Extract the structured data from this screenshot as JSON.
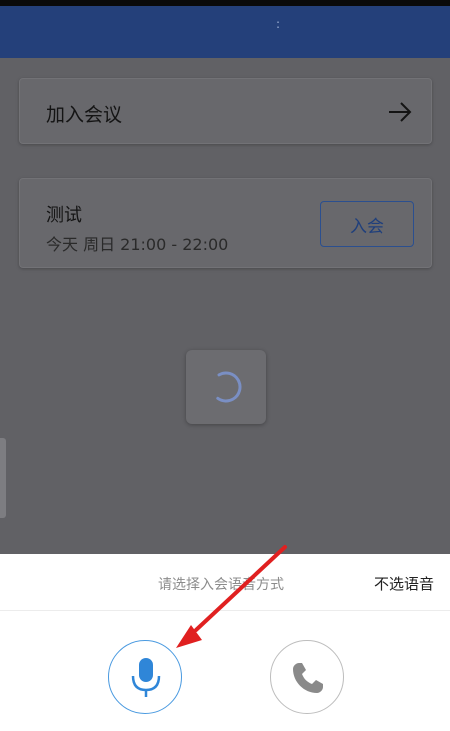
{
  "header": {
    "dots": ":"
  },
  "join_card": {
    "label": "加入会议",
    "icon": "arrow-right-icon"
  },
  "meeting": {
    "title": "测试",
    "time": "今天 周日  21:00 - 22:00",
    "join_label": "入会"
  },
  "loader": {
    "icon": "spinner-icon"
  },
  "voice_sheet": {
    "title": "请选择入会语音方式",
    "skip_label": "不选语音",
    "options": [
      {
        "icon": "microphone-icon"
      },
      {
        "icon": "phone-icon"
      }
    ]
  },
  "annotation": {
    "icon": "red-arrow-icon",
    "color": "#e02020"
  },
  "colors": {
    "brand": "#24407a",
    "accent": "#4a9ae0"
  }
}
